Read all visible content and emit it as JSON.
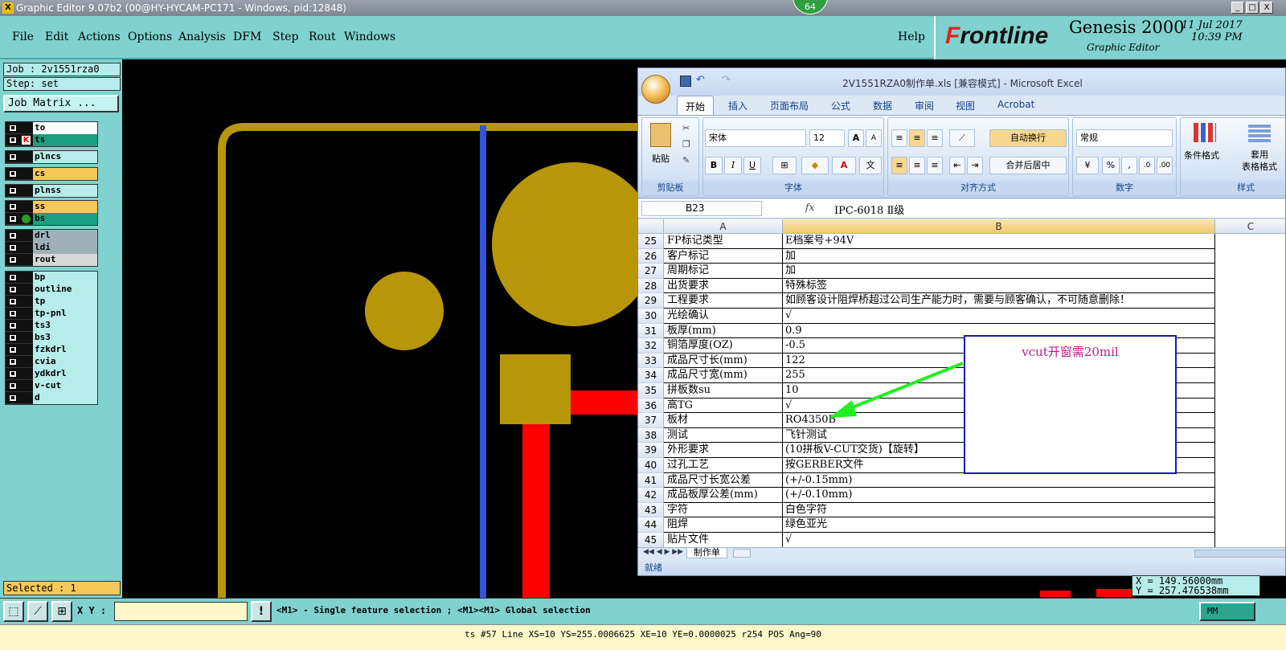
{
  "window": {
    "title": "Graphic Editor 9.07b2 (00@HY-HYCAM-PC171 - Windows, pid:12848)",
    "badge": "64",
    "controls": [
      "_",
      "□",
      "X"
    ]
  },
  "menu": {
    "items": [
      "File",
      "Edit",
      "Actions",
      "Options",
      "Analysis",
      "DFM",
      "Step",
      "Rout",
      "Windows"
    ],
    "help": "Help"
  },
  "brand": {
    "logo_f": "F",
    "logo_rest": "rontline",
    "product": "Genesis 2000",
    "subtitle": "Graphic Editor",
    "date": "11 Jul 2017",
    "time": "10:39 PM"
  },
  "left": {
    "job": "Job : 2v1551rza0",
    "step": "Step: set",
    "job_matrix": "Job Matrix ..."
  },
  "layers": [
    {
      "name": "to",
      "color": "#ffffff"
    },
    {
      "name": "ts",
      "color": "#1aa080"
    },
    {
      "name": "plncs",
      "color": "#b6ece9"
    },
    {
      "name": "cs",
      "color": "#f6c85a"
    },
    {
      "name": "plnss",
      "color": "#b6ece9"
    },
    {
      "name": "ss",
      "color": "#f6c85a"
    },
    {
      "name": "bs",
      "color": "#1aa080"
    },
    {
      "name": "drl",
      "color": "#9fb0b8"
    },
    {
      "name": "ldi",
      "color": "#9fb0b8"
    },
    {
      "name": "rout",
      "color": "#d8d8d8"
    },
    {
      "name": "bp",
      "color": "#b6ece9"
    },
    {
      "name": "outline",
      "color": "#b6ece9"
    },
    {
      "name": "tp",
      "color": "#b6ece9"
    },
    {
      "name": "tp-pnl",
      "color": "#b6ece9"
    },
    {
      "name": "ts3",
      "color": "#b6ece9"
    },
    {
      "name": "bs3",
      "color": "#b6ece9"
    },
    {
      "name": "fzkdrl",
      "color": "#b6ece9"
    },
    {
      "name": "cvia",
      "color": "#b6ece9"
    },
    {
      "name": "ydkdrl",
      "color": "#b6ece9"
    },
    {
      "name": "v-cut",
      "color": "#b6ece9"
    },
    {
      "name": "d",
      "color": "#b6ece9"
    }
  ],
  "selected": "Selected : 1",
  "bottom": {
    "xy_label": "X Y :",
    "hint": "<M1> - Single feature selection ; <M1><M1> Global selection",
    "units": "MM",
    "status": "ts #57 Line XS=10 YS=255.0006625 XE=10 YE=0.0000025 r254 POS Ang=90"
  },
  "coords": {
    "x": "X = 149.56000mm",
    "y": "Y = 257.476538mm"
  },
  "excel": {
    "title": "2V1551RZA0制作单.xls [兼容模式] - Microsoft Excel",
    "tabs": [
      "开始",
      "插入",
      "页面布局",
      "公式",
      "数据",
      "审阅",
      "视图",
      "Acrobat"
    ],
    "groups": {
      "clipboard": "剪贴板",
      "font": "字体",
      "align": "对齐方式",
      "number": "数字",
      "style": "样式"
    },
    "ribbon": {
      "paste": "粘贴",
      "font_name": "宋体",
      "font_size": "12",
      "wrap": "自动换行",
      "merge": "合并后居中",
      "number_format": "常规",
      "cond_format": "条件格式",
      "table_format": "套用\n表格格式"
    },
    "name_box": "B23",
    "fx": "fx",
    "formula": "IPC-6018 Ⅱ级",
    "columns": [
      "A",
      "B",
      "C"
    ],
    "rows": [
      {
        "n": "25",
        "a": "FP标记类型",
        "b": "E档案号+94V"
      },
      {
        "n": "26",
        "a": "客户标记",
        "b": "加"
      },
      {
        "n": "27",
        "a": "周期标记",
        "b": "加"
      },
      {
        "n": "28",
        "a": "出货要求",
        "b": "特殊标签"
      },
      {
        "n": "29",
        "a": "工程要求",
        "b": "如顾客设计阻焊桥超过公司生产能力时，需要与顾客确认，不可随意删除！"
      },
      {
        "n": "30",
        "a": "光绘确认",
        "b": "√"
      },
      {
        "n": "31",
        "a": "板厚(mm)",
        "b": "0.9"
      },
      {
        "n": "32",
        "a": "铜箔厚度(OZ)",
        "b": "-0.5"
      },
      {
        "n": "33",
        "a": "成品尺寸长(mm)",
        "b": "122"
      },
      {
        "n": "34",
        "a": "成品尺寸宽(mm)",
        "b": "255"
      },
      {
        "n": "35",
        "a": "拼板数su",
        "b": "10"
      },
      {
        "n": "36",
        "a": "高TG",
        "b": "√"
      },
      {
        "n": "37",
        "a": "板材",
        "b": "RO4350B"
      },
      {
        "n": "38",
        "a": "测试",
        "b": "飞针测试"
      },
      {
        "n": "39",
        "a": "外形要求",
        "b": "(10拼板V-CUT交货)【旋转】"
      },
      {
        "n": "40",
        "a": "过孔工艺",
        "b": "按GERBER文件"
      },
      {
        "n": "41",
        "a": "成品尺寸长宽公差",
        "b": "(+/-0.15mm)"
      },
      {
        "n": "42",
        "a": "成品板厚公差(mm)",
        "b": "(+/-0.10mm)"
      },
      {
        "n": "43",
        "a": "字符",
        "b": "白色字符"
      },
      {
        "n": "44",
        "a": "阻焊",
        "b": "绿色亚光"
      },
      {
        "n": "45",
        "a": "贴片文件",
        "b": "√"
      }
    ],
    "sheet_tab": "制作单",
    "status": "就绪"
  },
  "annotation": "vcut开窗需20mil",
  "colors": {
    "copper": "#b8960a",
    "blue_line": "#3355dd",
    "red_feature": "#ff0000",
    "arrow": "#22ee22",
    "panel": "#7fd2cf"
  }
}
